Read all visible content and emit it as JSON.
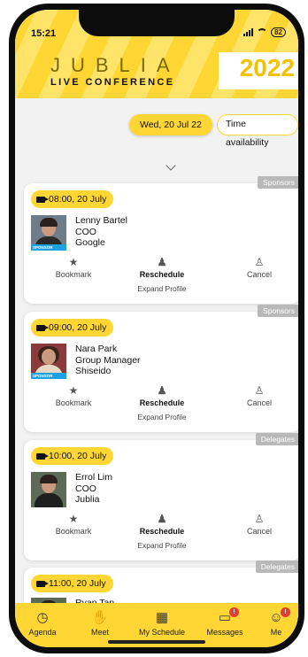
{
  "status_bar": {
    "time": "15:21",
    "battery": "82"
  },
  "header": {
    "brand": "JUBLIA",
    "subtitle": "LIVE CONFERENCE",
    "year": "2022"
  },
  "filters": {
    "date": "Wed, 20 Jul 22",
    "availability": "Time availability"
  },
  "actions": {
    "bookmark": "Bookmark",
    "reschedule": "Reschedule",
    "cancel": "Cancel",
    "expand": "Expand Profile"
  },
  "meetings": [
    {
      "tag": "Sponsors",
      "time": "08:00, 20 July",
      "name": "Lenny Bartel",
      "role": "COO",
      "company": "Google",
      "badge": "SPONSOR"
    },
    {
      "tag": "Sponsors",
      "time": "09:00, 20 July",
      "name": "Nara Park",
      "role": "Group Manager",
      "company": "Shiseido",
      "badge": "SPONSOR"
    },
    {
      "tag": "Delegates",
      "time": "10:00, 20 July",
      "name": "Errol Lim",
      "role": "COO",
      "company": "Jublia"
    },
    {
      "tag": "Delegates",
      "time": "11:00, 20 July",
      "name": "Ryan Tan"
    }
  ],
  "nav": [
    {
      "label": "Agenda",
      "icon": "clock-icon"
    },
    {
      "label": "Meet",
      "icon": "handshake-icon"
    },
    {
      "label": "My Schedule",
      "icon": "calendar-icon"
    },
    {
      "label": "Messages",
      "icon": "message-icon",
      "badge": "!"
    },
    {
      "label": "Me",
      "icon": "smiley-icon",
      "badge": "!"
    }
  ],
  "colors": {
    "accent": "#ffd633",
    "tag": "#b9b9b9",
    "sponsor": "#1da1e0",
    "alert": "#e53935"
  }
}
